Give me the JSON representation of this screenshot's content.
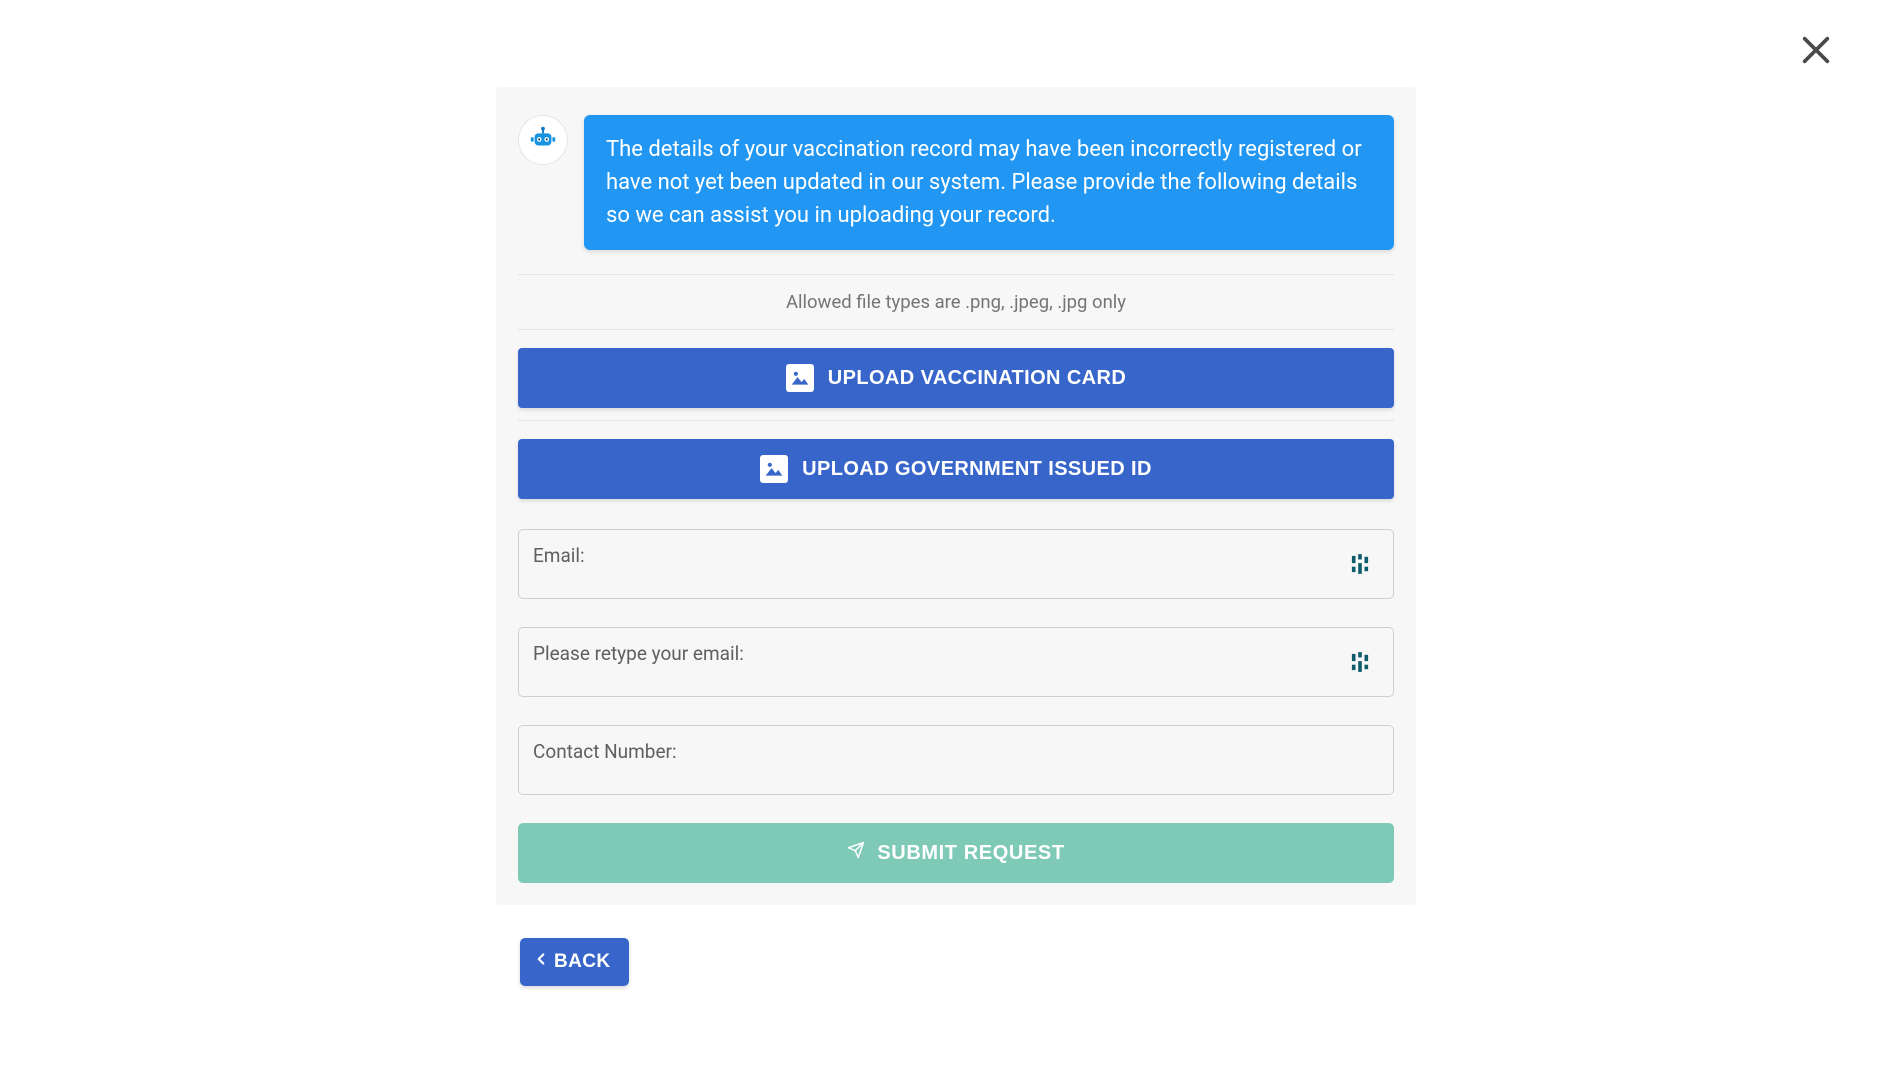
{
  "message": "The details of your vaccination record may have been incorrectly registered or have not yet been updated in our system. Please provide the following details so we can assist you in uploading your record.",
  "allowed_types_text": "Allowed file types are .png, .jpeg, .jpg only",
  "upload_buttons": {
    "vaccination_card": "UPLOAD VACCINATION CARD",
    "gov_id": "UPLOAD GOVERNMENT ISSUED ID"
  },
  "fields": {
    "email_label": "Email:",
    "email_confirm_label": "Please retype your email:",
    "contact_label": "Contact Number:"
  },
  "submit_label": "SUBMIT REQUEST",
  "back_label": "BACK",
  "colors": {
    "bubble": "#2196f3",
    "primary_button": "#3765c9",
    "submit_button": "#7fcab6"
  }
}
